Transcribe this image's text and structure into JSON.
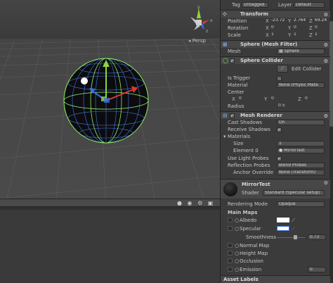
{
  "scene": {
    "persp_label": "Persp",
    "gizmo_axes": {
      "y": "y",
      "x": "x",
      "z": "z"
    }
  },
  "toolbar_icons": [
    "scene-sphere-icon",
    "scene-eye-icon",
    "scene-gear-icon"
  ],
  "inspector": {
    "top": {
      "tag_label": "Tag",
      "tag_value": "Untagged",
      "layer_label": "Layer",
      "layer_value": "Default"
    },
    "transform": {
      "title": "Transform",
      "position": {
        "label": "Position",
        "x": "-23.72",
        "y": "2.764",
        "z": "69.24"
      },
      "rotation": {
        "label": "Rotation",
        "x": "0",
        "y": "0",
        "z": "0"
      },
      "scale": {
        "label": "Scale",
        "x": "1",
        "y": "1",
        "z": "1"
      }
    },
    "mesh_filter": {
      "title": "Sphere (Mesh Filter)",
      "mesh_label": "Mesh",
      "mesh_value": "Sphere"
    },
    "sphere_collider": {
      "title": "Sphere Collider",
      "edit_label": "Edit Collider",
      "is_trigger_label": "Is Trigger",
      "material_label": "Material",
      "material_value": "None (Physic Mate",
      "center_label": "Center",
      "center": {
        "x": "0",
        "y": "0",
        "z": "0"
      },
      "radius_label": "Radius",
      "radius_value": "0.5"
    },
    "mesh_renderer": {
      "title": "Mesh Renderer",
      "cast_shadows_label": "Cast Shadows",
      "cast_shadows_value": "On",
      "receive_shadows_label": "Receive Shadows",
      "materials_label": "Materials",
      "size_label": "Size",
      "size_value": "1",
      "element0_label": "Element 0",
      "element0_value": "MirrorTest",
      "light_probes_label": "Use Light Probes",
      "reflection_probes_label": "Reflection Probes",
      "reflection_probes_value": "Blend Probes",
      "anchor_label": "Anchor Override",
      "anchor_value": "None (Transform)"
    },
    "material": {
      "name": "MirrorTest",
      "shader_label": "Shader",
      "shader_value": "Standard (Specular setup)",
      "rendering_mode_label": "Rendering Mode",
      "rendering_mode_value": "Opaque",
      "main_maps_label": "Main Maps",
      "albedo_label": "Albedo",
      "specular_label": "Specular",
      "smoothness_label": "Smoothness",
      "smoothness_value": "0.73",
      "normal_label": "Normal Map",
      "height_label": "Height Map",
      "occlusion_label": "Occlusion",
      "emission_label": "Emission",
      "emission_value": "0"
    },
    "asset_labels": "Asset Labels"
  },
  "colors": {
    "gizmo_y": "#8fd63a",
    "gizmo_x": "#e0392b",
    "gizmo_z": "#3a6fe0",
    "collider": "#8cf060",
    "wire": "#4a78d6"
  }
}
